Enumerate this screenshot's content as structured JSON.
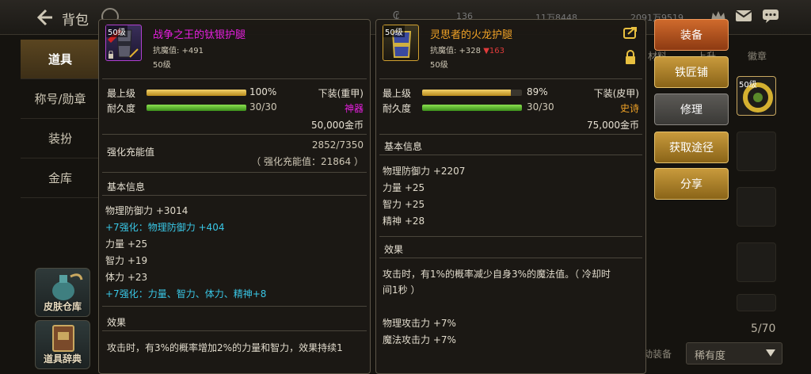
{
  "header": {
    "title": "背包",
    "stats": [
      "136",
      "11万8448",
      "2091万9519"
    ]
  },
  "left_menu": {
    "items": [
      {
        "label": "道具",
        "active": true
      },
      {
        "label": "称号/勋章",
        "active": false
      },
      {
        "label": "装扮",
        "active": false
      },
      {
        "label": "金库",
        "active": false
      }
    ],
    "shortcuts": [
      {
        "label": "皮肤仓库"
      },
      {
        "label": "道具辞典"
      }
    ]
  },
  "inventory": {
    "tabs": [
      "材料",
      "上升",
      "徽章"
    ],
    "level_badge": "50级",
    "count": "5/70",
    "auto_equip": "动装备",
    "sort_value": "稀有度"
  },
  "item_a": {
    "level_badge": "50级",
    "name": "战争之王的钛银护腿",
    "resist": "抗魔值: +491",
    "level": "50级",
    "max_level_label": "最上级",
    "max_level_value": 1.0,
    "max_level_pct": "100%",
    "slot": "下装(重甲)",
    "durability_label": "耐久度",
    "durability_value": 1.0,
    "durability_text": "30/30",
    "rarity": "神器",
    "price": "50,000金币",
    "enhance_label": "强化充能值",
    "enhance_value": "2852/7350",
    "enhance_sub": "（ 强化充能值：21864 ）",
    "basic_header": "基本信息",
    "stats": [
      {
        "text": "物理防御力 +3014",
        "color": "#e0dacb"
      },
      {
        "text": "+7强化：物理防御力 +404",
        "color": "#39c7e6"
      },
      {
        "text": "力量 +25",
        "color": "#e0dacb"
      },
      {
        "text": "智力 +19",
        "color": "#e0dacb"
      },
      {
        "text": "体力 +23",
        "color": "#e0dacb"
      },
      {
        "text": "+7强化：力量、智力、体力、精神+8",
        "color": "#39c7e6"
      }
    ],
    "effect_header": "效果",
    "effect_text": "攻击时，有3%的概率增加2%的力量和智力，效果持续1"
  },
  "item_b": {
    "level_badge": "50级",
    "name": "灵思者的火龙护腿",
    "resist_prefix": "抗魔值: +328",
    "resist_delta": "▼163",
    "level": "50级",
    "max_level_label": "最上级",
    "max_level_value": 0.89,
    "max_level_pct": "89%",
    "slot": "下装(皮甲)",
    "durability_label": "耐久度",
    "durability_value": 1.0,
    "durability_text": "30/30",
    "rarity": "史诗",
    "price": "75,000金币",
    "basic_header": "基本信息",
    "stats": [
      "物理防御力 +2207",
      "力量 +25",
      "智力 +25",
      "精神 +28"
    ],
    "effect_header": "效果",
    "effect_line1": "攻击时，有1%的概率减少自身3%的魔法值。（ 冷却时",
    "effect_line2": "间1秒 ）",
    "extra": [
      "物理攻击力 +7%",
      "魔法攻击力 +7%"
    ]
  },
  "actions": {
    "equip": "装备",
    "blacksmith": "铁匠铺",
    "repair": "修理",
    "obtain": "获取途径",
    "share": "分享"
  },
  "colors": {
    "magenta": "#e81fe0",
    "orange": "#f0a226",
    "cyan": "#39c7e6",
    "down_red": "#e03b3b"
  }
}
